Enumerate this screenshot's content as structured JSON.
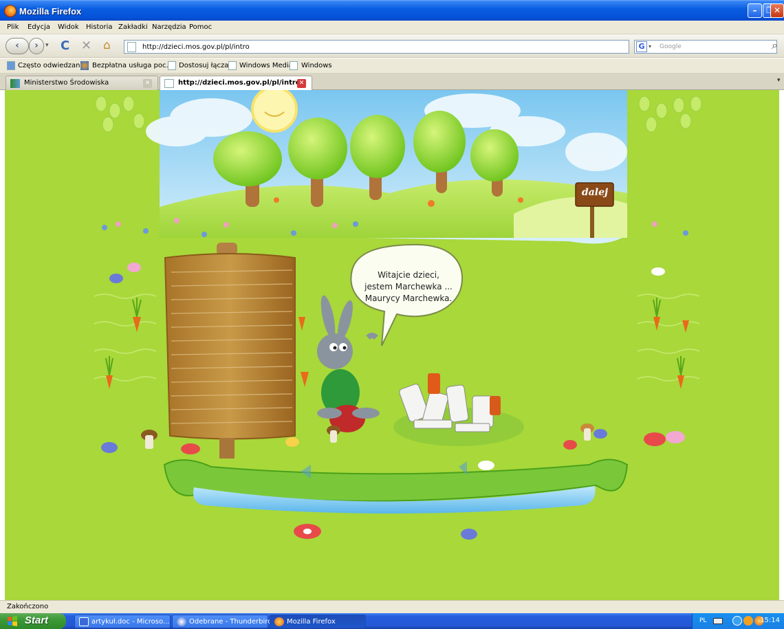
{
  "window": {
    "title": "Mozilla Firefox"
  },
  "menu": [
    "Plik",
    "Edycja",
    "Widok",
    "Historia",
    "Zakładki",
    "Narzędzia",
    "Pomoc"
  ],
  "nav": {
    "url": "http://dzieci.mos.gov.pl/pl/intro",
    "search_placeholder": "Google"
  },
  "bookmarks": [
    "Często odwiedzane",
    "Bezpłatna usługa poc...",
    "Dostosuj łącza",
    "Windows Media",
    "Windows"
  ],
  "tabs": [
    {
      "label": "Ministerstwo Środowiska",
      "active": false
    },
    {
      "label": "http://dzieci.mos.gov.pl/pl/intro",
      "active": true
    }
  ],
  "page": {
    "speech_lines": [
      "Witajcie dzieci,",
      "jestem Marchewka ...",
      "Maurycy Marchewka."
    ],
    "signpost_label": "dalej"
  },
  "status": {
    "text": "Zakończono"
  },
  "taskbar": {
    "start_label": "Start",
    "tasks": [
      {
        "label": "artykuł.doc - Microso...",
        "active": false
      },
      {
        "label": "Odebrane - Thunderbird",
        "active": false
      },
      {
        "label": "Mozilla Firefox",
        "active": true
      }
    ],
    "language": "PL",
    "clock": "15:14"
  },
  "colors": {
    "content_bg": "#a8d83a",
    "titlebar": "#0a5ee0",
    "taskbar": "#245edc",
    "start_green": "#3c9a36"
  }
}
